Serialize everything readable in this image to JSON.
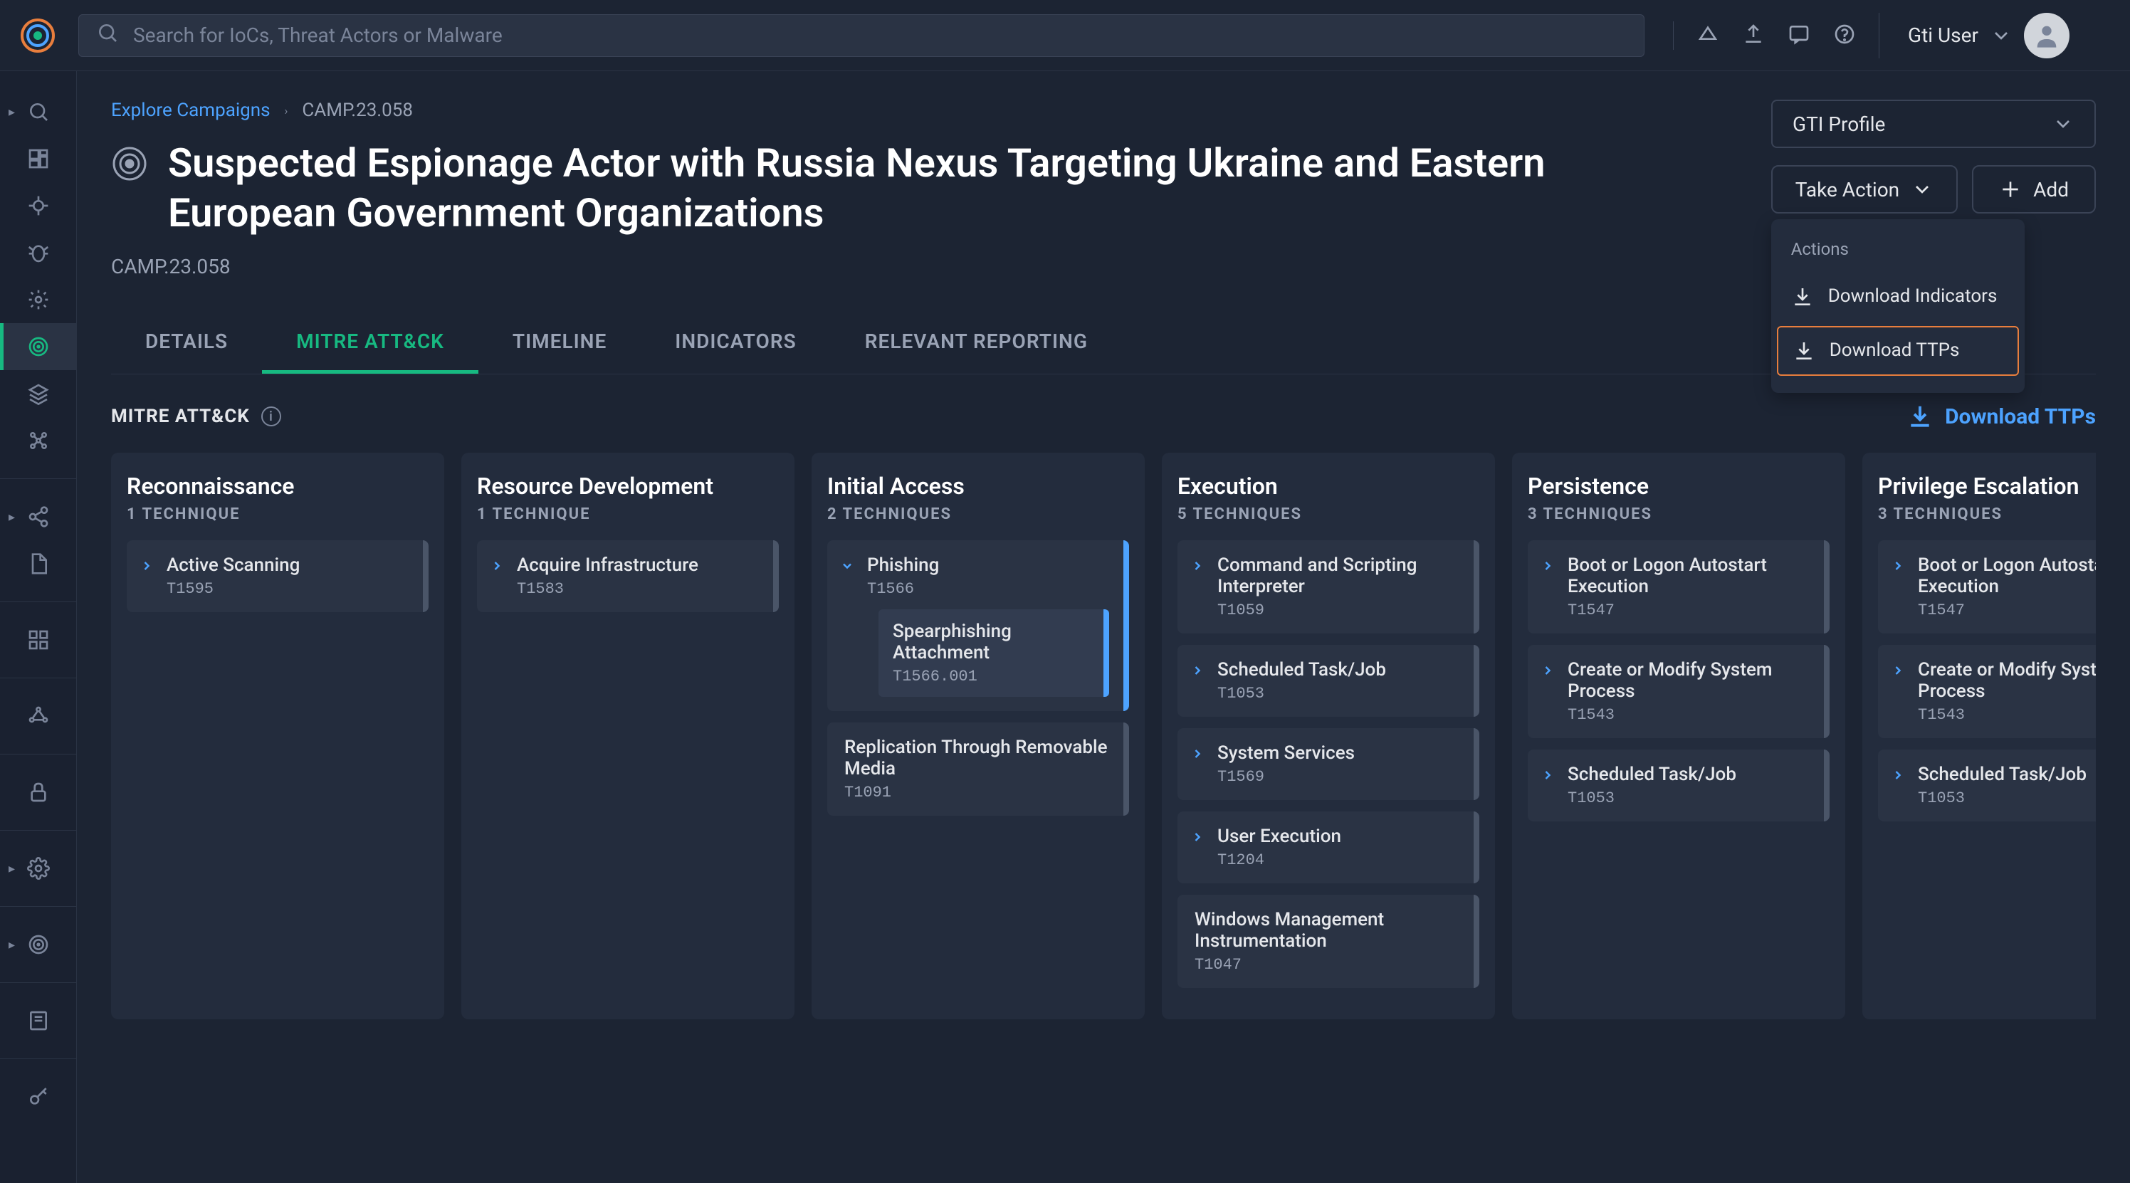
{
  "header": {
    "search_placeholder": "Search for IoCs, Threat Actors or Malware",
    "user_name": "Gti User"
  },
  "breadcrumb": {
    "parent": "Explore Campaigns",
    "current": "CAMP.23.058"
  },
  "page": {
    "title": "Suspected Espionage Actor with Russia Nexus Targeting Ukraine and Eastern European Government Organizations",
    "subtitle": "CAMP.23.058",
    "profile_label": "GTI Profile",
    "take_action_label": "Take Action",
    "add_label": "Add"
  },
  "dropdown": {
    "header": "Actions",
    "item1": "Download Indicators",
    "item2": "Download TTPs"
  },
  "tabs": {
    "details": "DETAILS",
    "mitre": "MITRE ATT&CK",
    "timeline": "TIMELINE",
    "indicators": "INDICATORS",
    "relevant": "RELEVANT REPORTING"
  },
  "mitre": {
    "label": "MITRE ATT&CK",
    "download_link": "Download TTPs"
  },
  "tactics": [
    {
      "name": "Reconnaissance",
      "count": "1 TECHNIQUE",
      "techniques": [
        {
          "name": "Active Scanning",
          "id": "T1595"
        }
      ]
    },
    {
      "name": "Resource Development",
      "count": "1 TECHNIQUE",
      "techniques": [
        {
          "name": "Acquire Infrastructure",
          "id": "T1583"
        }
      ]
    },
    {
      "name": "Initial Access",
      "count": "2 TECHNIQUES",
      "techniques": [
        {
          "name": "Phishing",
          "id": "T1566",
          "expanded": true,
          "sub": {
            "name": "Spearphishing Attachment",
            "id": "T1566.001"
          }
        },
        {
          "name": "Replication Through Removable Media",
          "id": "T1091",
          "no_chevron": true
        }
      ]
    },
    {
      "name": "Execution",
      "count": "5 TECHNIQUES",
      "techniques": [
        {
          "name": "Command and Scripting Interpreter",
          "id": "T1059"
        },
        {
          "name": "Scheduled Task/Job",
          "id": "T1053"
        },
        {
          "name": "System Services",
          "id": "T1569"
        },
        {
          "name": "User Execution",
          "id": "T1204"
        },
        {
          "name": "Windows Management Instrumentation",
          "id": "T1047",
          "no_chevron": true
        }
      ]
    },
    {
      "name": "Persistence",
      "count": "3 TECHNIQUES",
      "techniques": [
        {
          "name": "Boot or Logon Autostart Execution",
          "id": "T1547"
        },
        {
          "name": "Create or Modify System Process",
          "id": "T1543"
        },
        {
          "name": "Scheduled Task/Job",
          "id": "T1053"
        }
      ]
    },
    {
      "name": "Privilege Escalation",
      "count": "3 TECHNIQUES",
      "techniques": [
        {
          "name": "Boot or Logon Autostart Execution",
          "id": "T1547"
        },
        {
          "name": "Create or Modify System Process",
          "id": "T1543"
        },
        {
          "name": "Scheduled Task/Job",
          "id": "T1053"
        }
      ]
    }
  ]
}
